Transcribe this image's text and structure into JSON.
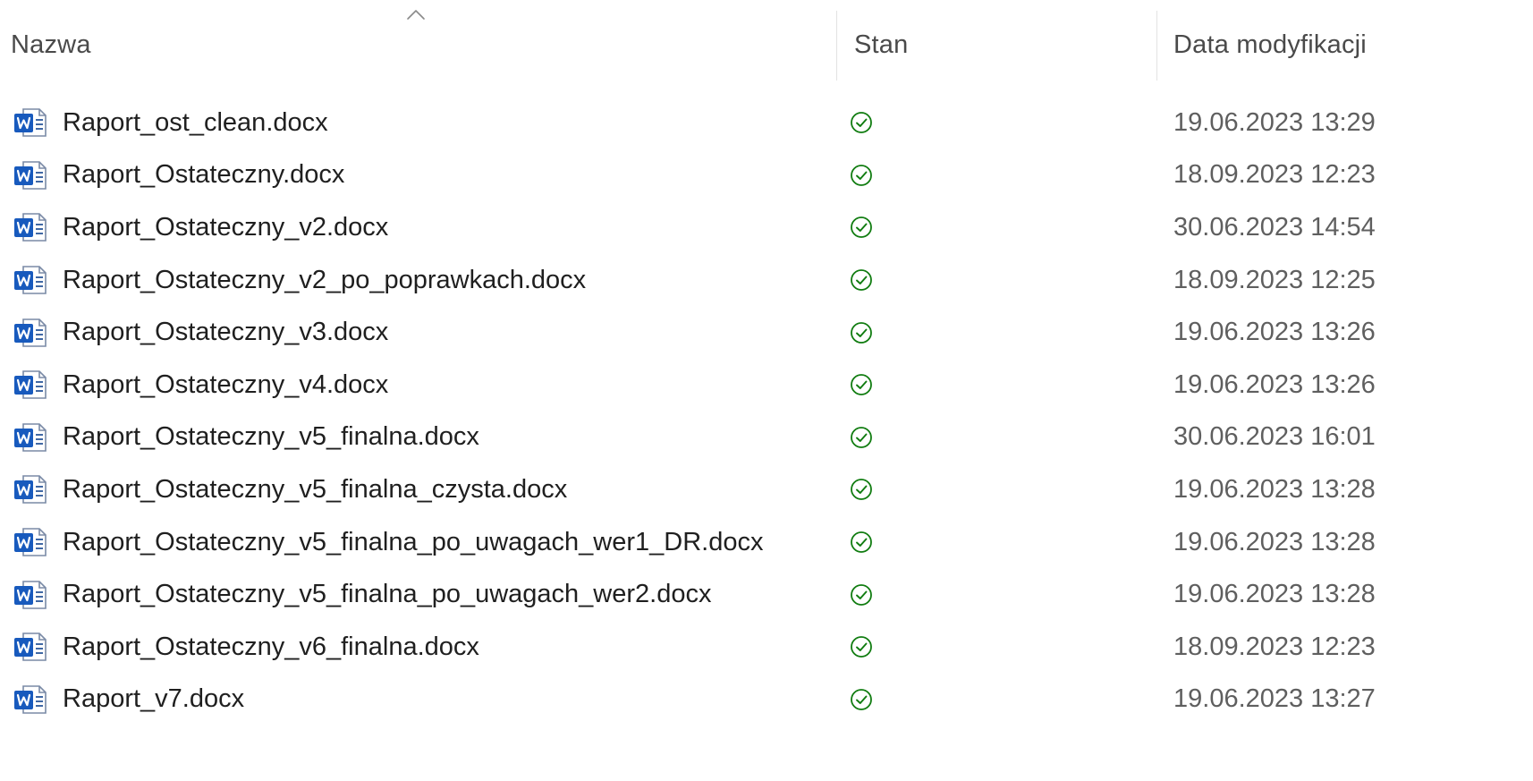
{
  "columns": {
    "name": "Nazwa",
    "status": "Stan",
    "modified": "Data modyfikacji"
  },
  "sort": {
    "column": "name",
    "direction": "ascending",
    "icon": "chevron-up-icon"
  },
  "colors": {
    "word_icon_blue": "#185abd",
    "status_green": "#107c10",
    "date_text": "#5f5f5f",
    "header_text": "#4a4a4a"
  },
  "files": [
    {
      "name": "Raport_ost_clean.docx",
      "icon": "word-document-icon",
      "status": "synced-check-icon",
      "modified": "19.06.2023 13:29"
    },
    {
      "name": "Raport_Ostateczny.docx",
      "icon": "word-document-icon",
      "status": "synced-check-icon",
      "modified": "18.09.2023 12:23"
    },
    {
      "name": "Raport_Ostateczny_v2.docx",
      "icon": "word-document-icon",
      "status": "synced-check-icon",
      "modified": "30.06.2023 14:54"
    },
    {
      "name": "Raport_Ostateczny_v2_po_poprawkach.docx",
      "icon": "word-document-icon",
      "status": "synced-check-icon",
      "modified": "18.09.2023 12:25"
    },
    {
      "name": "Raport_Ostateczny_v3.docx",
      "icon": "word-document-icon",
      "status": "synced-check-icon",
      "modified": "19.06.2023 13:26"
    },
    {
      "name": "Raport_Ostateczny_v4.docx",
      "icon": "word-document-icon",
      "status": "synced-check-icon",
      "modified": "19.06.2023 13:26"
    },
    {
      "name": "Raport_Ostateczny_v5_finalna.docx",
      "icon": "word-document-icon",
      "status": "synced-check-icon",
      "modified": "30.06.2023 16:01"
    },
    {
      "name": "Raport_Ostateczny_v5_finalna_czysta.docx",
      "icon": "word-document-icon",
      "status": "synced-check-icon",
      "modified": "19.06.2023 13:28"
    },
    {
      "name": "Raport_Ostateczny_v5_finalna_po_uwagach_wer1_DR.docx",
      "icon": "word-document-icon",
      "status": "synced-check-icon",
      "modified": "19.06.2023 13:28"
    },
    {
      "name": "Raport_Ostateczny_v5_finalna_po_uwagach_wer2.docx",
      "icon": "word-document-icon",
      "status": "synced-check-icon",
      "modified": "19.06.2023 13:28"
    },
    {
      "name": "Raport_Ostateczny_v6_finalna.docx",
      "icon": "word-document-icon",
      "status": "synced-check-icon",
      "modified": "18.09.2023 12:23"
    },
    {
      "name": "Raport_v7.docx",
      "icon": "word-document-icon",
      "status": "synced-check-icon",
      "modified": "19.06.2023 13:27"
    }
  ]
}
